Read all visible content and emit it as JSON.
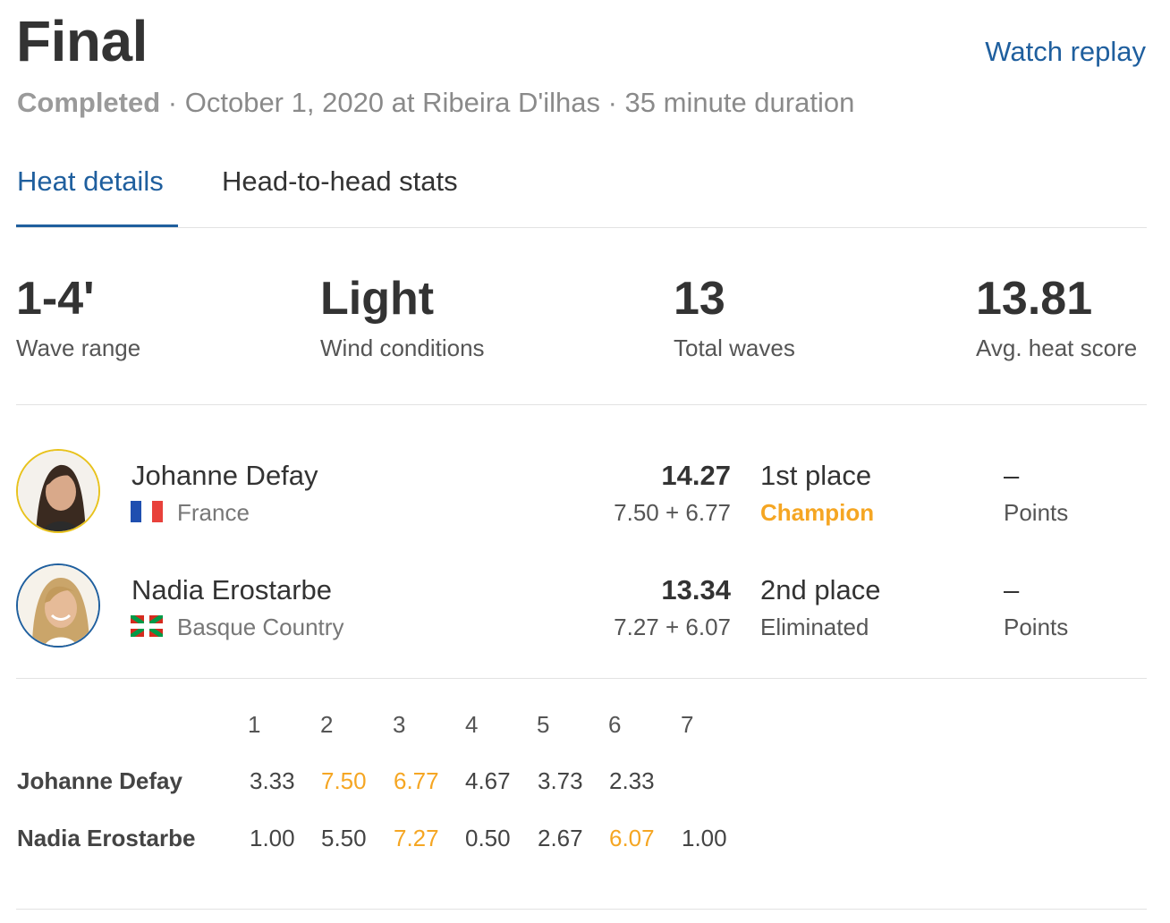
{
  "header": {
    "title": "Final",
    "watch_replay": "Watch replay",
    "status": "Completed",
    "details": " · October 1, 2020 at Ribeira D'ilhas · 35 minute duration"
  },
  "tabs": [
    {
      "label": "Heat details",
      "active": true
    },
    {
      "label": "Head-to-head stats",
      "active": false
    }
  ],
  "stats": [
    {
      "value": "1-4'",
      "label": "Wave range"
    },
    {
      "value": "Light",
      "label": "Wind conditions"
    },
    {
      "value": "13",
      "label": "Total waves"
    },
    {
      "value": "13.81",
      "label": "Avg. heat score"
    }
  ],
  "surfers": [
    {
      "name": "Johanne Defay",
      "country": "France",
      "score": "14.27",
      "breakdown": "7.50 + 6.77",
      "place": "1st place",
      "result": "Champion",
      "points": "–",
      "points_label": "Points",
      "ring_color": "#e8c21c"
    },
    {
      "name": "Nadia Erostarbe",
      "country": "Basque Country",
      "score": "13.34",
      "breakdown": "7.27 + 6.07",
      "place": "2nd place",
      "result": "Eliminated",
      "points": "–",
      "points_label": "Points",
      "ring_color": "#1f5f9e"
    }
  ],
  "waves": {
    "headers": [
      "1",
      "2",
      "3",
      "4",
      "5",
      "6",
      "7"
    ],
    "rows": [
      {
        "name": "Johanne Defay",
        "scores": [
          "3.33",
          "7.50",
          "6.77",
          "4.67",
          "3.73",
          "2.33",
          ""
        ],
        "highlight": [
          false,
          true,
          true,
          false,
          false,
          false,
          false
        ]
      },
      {
        "name": "Nadia Erostarbe",
        "scores": [
          "1.00",
          "5.50",
          "7.27",
          "0.50",
          "2.67",
          "6.07",
          "1.00"
        ],
        "highlight": [
          false,
          false,
          true,
          false,
          false,
          true,
          false
        ]
      }
    ]
  },
  "colors": {
    "accent": "#1f5f9e",
    "highlight": "#f5a623",
    "text": "#333333"
  }
}
